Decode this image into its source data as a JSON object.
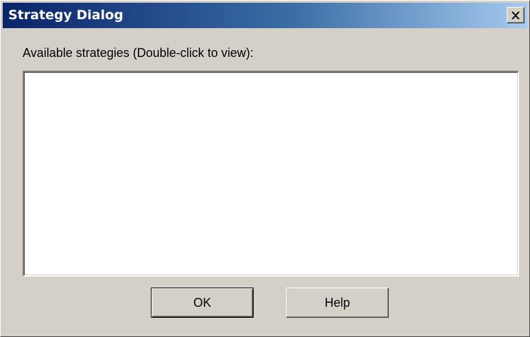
{
  "dialog": {
    "title": "Strategy Dialog",
    "prompt": "Available strategies (Double-click to view):",
    "strategies": [],
    "close_icon": "close-icon"
  },
  "buttons": {
    "ok_label": "OK",
    "help_label": "Help"
  },
  "colors": {
    "title_gradient_start": "#0a246a",
    "title_gradient_end": "#a6caf0",
    "face": "#d4d0c8",
    "list_background": "#ffffff"
  }
}
